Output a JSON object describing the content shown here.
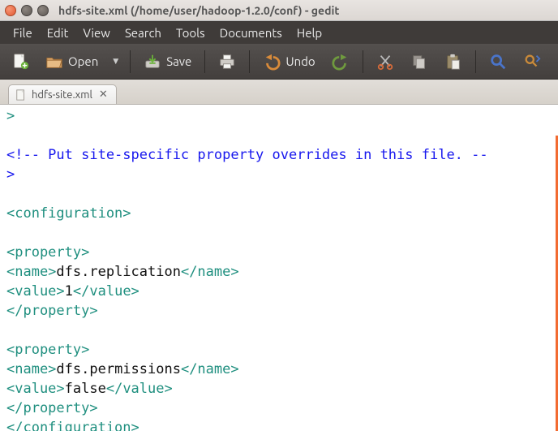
{
  "window": {
    "title": "hdfs-site.xml (/home/user/hadoop-1.2.0/conf) - gedit"
  },
  "menubar": {
    "items": [
      "File",
      "Edit",
      "View",
      "Search",
      "Tools",
      "Documents",
      "Help"
    ]
  },
  "toolbar": {
    "open_label": "Open",
    "save_label": "Save",
    "undo_label": "Undo"
  },
  "tab": {
    "label": "hdfs-site.xml"
  },
  "editor": {
    "lines": [
      {
        "type": "tag",
        "text": ">"
      },
      {
        "type": "blank",
        "text": ""
      },
      {
        "type": "comment",
        "text": "<!-- Put site-specific property overrides in this file. --"
      },
      {
        "type": "comment",
        "text": ">"
      },
      {
        "type": "blank",
        "text": ""
      },
      {
        "type": "onetag",
        "open": "<configuration>"
      },
      {
        "type": "blank",
        "text": ""
      },
      {
        "type": "onetag",
        "open": "<property>"
      },
      {
        "type": "kv",
        "open": "<name>",
        "content": "dfs.replication",
        "close": "</name>"
      },
      {
        "type": "kv",
        "open": "<value>",
        "content": "1",
        "close": "</value>"
      },
      {
        "type": "onetag",
        "open": "</property>"
      },
      {
        "type": "blank",
        "text": ""
      },
      {
        "type": "onetag",
        "open": "<property>"
      },
      {
        "type": "kv",
        "open": "<name>",
        "content": "dfs.permissions",
        "close": "</name>"
      },
      {
        "type": "kv",
        "open": "<value>",
        "content": "false",
        "close": "</value>"
      },
      {
        "type": "onetag",
        "open": "</property>"
      },
      {
        "type": "onetag",
        "open": "</configuration>"
      }
    ]
  }
}
